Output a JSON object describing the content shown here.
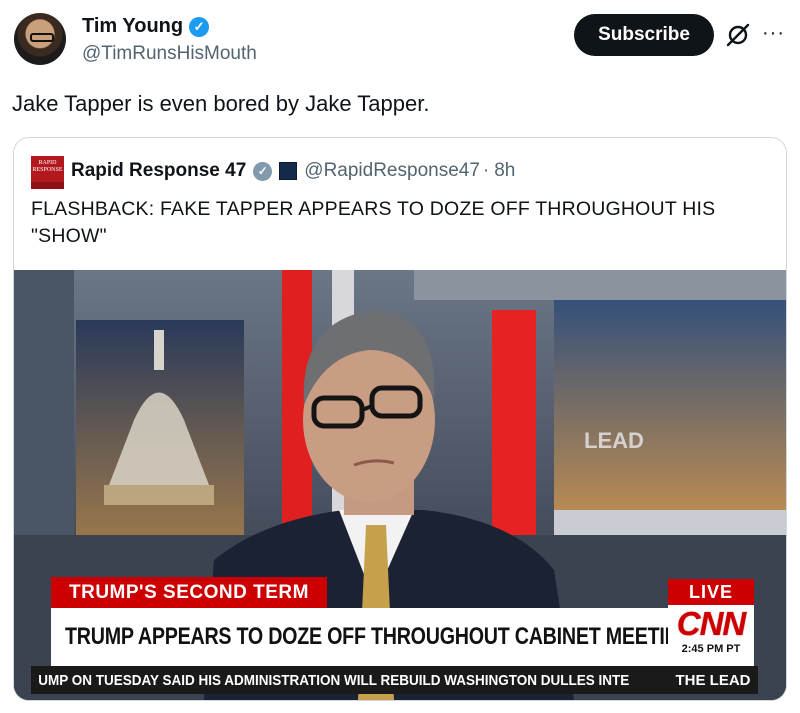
{
  "post": {
    "author_name": "Tim Young",
    "verified_glyph": "✓",
    "handle": "@TimRunsHisMouth",
    "subscribe_label": "Subscribe",
    "more_label": "···",
    "text": "Jake Tapper is even bored by Jake Tapper."
  },
  "quote": {
    "avatar_lines": [
      "RAPID",
      "RESPONSE"
    ],
    "author_name": "Rapid Response 47",
    "verified_glyph": "✓",
    "handle": "@RapidResponse47",
    "separator": "·",
    "time": "8h",
    "text_line1": "FLASHBACK: FAKE TAPPER APPEARS TO DOZE OFF THROUGHOUT HIS",
    "text_line2": "\"SHOW\""
  },
  "video": {
    "top_bar": "TRUMP'S SECOND TERM",
    "live": "LIVE",
    "headline": "TRUMP APPEARS TO DOZE OFF THROUGHOUT CABINET MEETING",
    "network_logo": "CNN",
    "time": "2:45 PM PT",
    "ticker": "UMP ON TUESDAY SAID HIS ADMINISTRATION WILL REBUILD WASHINGTON DULLES INTE",
    "show_name": "THE LEAD",
    "set_sign": "LEAD"
  },
  "icons": {
    "grok": "grok-icon",
    "more": "more-dots-icon",
    "verified": "verified-badge-icon",
    "white_house": "white-house-icon"
  },
  "colors": {
    "verified_blue": "#1d9bf0",
    "cnn_red": "#cc0000",
    "text_primary": "#0f1419",
    "text_secondary": "#536471"
  }
}
